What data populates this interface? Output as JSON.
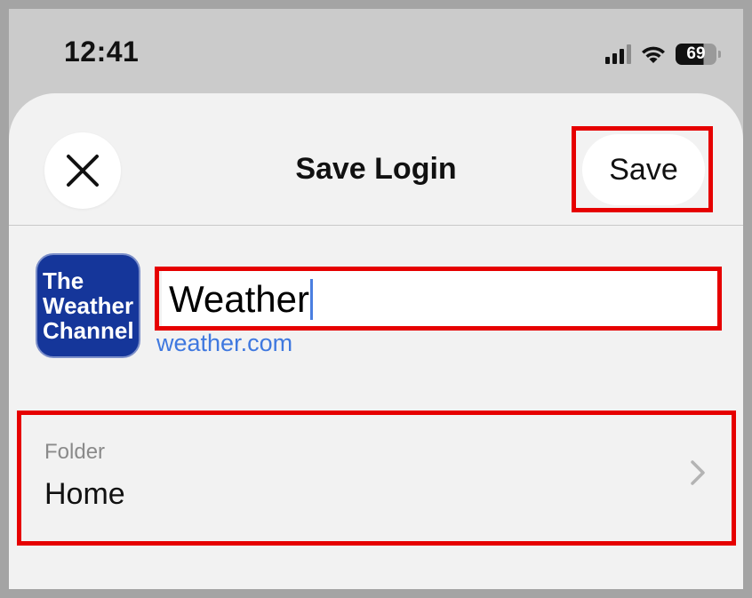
{
  "status_bar": {
    "time": "12:41",
    "battery": "69"
  },
  "sheet": {
    "title": "Save Login",
    "save_label": "Save",
    "close_icon": "close-icon"
  },
  "login": {
    "app_logo_text": [
      "The",
      "Weather",
      "Channel"
    ],
    "name_value": "Weather",
    "domain": "weather.com"
  },
  "folder": {
    "label": "Folder",
    "value": "Home",
    "chevron_icon": "chevron-right-icon"
  },
  "colors": {
    "highlight": "#e60000",
    "link": "#3f78df",
    "logo_bg": "#15369a"
  }
}
